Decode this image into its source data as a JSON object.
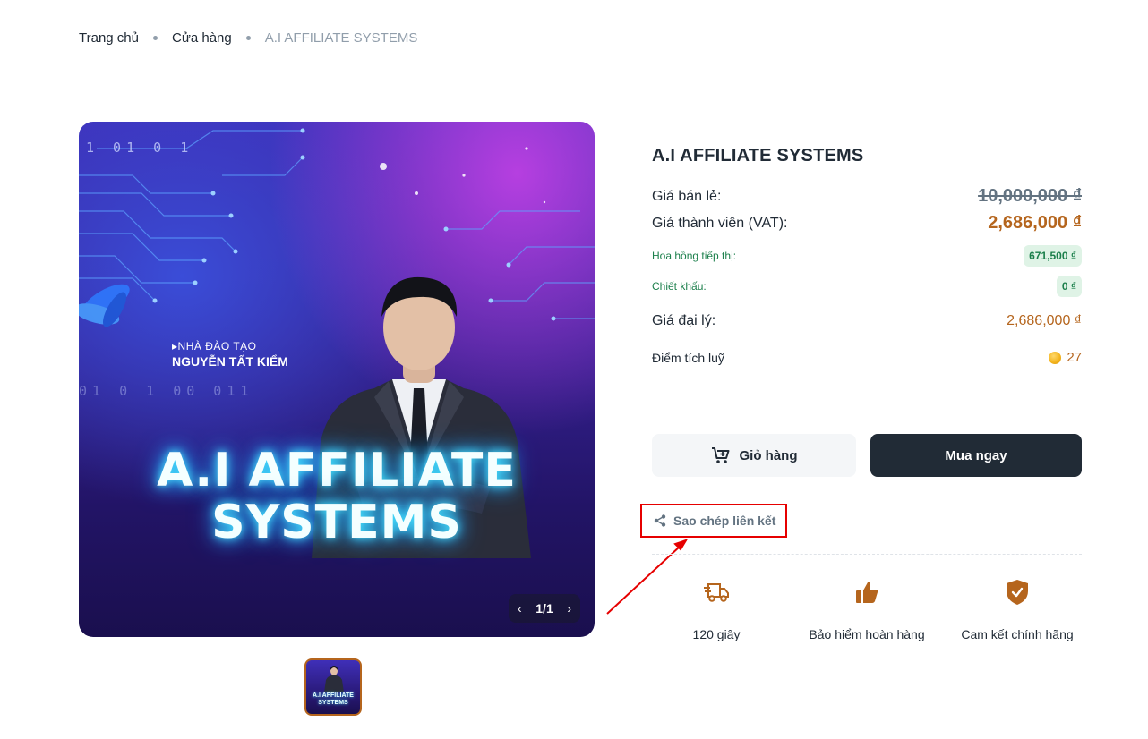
{
  "breadcrumb": {
    "items": [
      "Trang chủ",
      "Cửa hàng",
      "A.I AFFILIATE SYSTEMS"
    ]
  },
  "gallery": {
    "image_text": {
      "binary_top": "1   01 0 1",
      "binary_mid": "01 0 1  00  011",
      "trainer_label": "▸NHÀ ĐÀO TẠO",
      "trainer_name": "NGUYỄN TẤT KIỂM",
      "headline_line1": "A.I AFFILIATE",
      "headline_line2": "SYSTEMS"
    },
    "pager": "1/1",
    "thumbnail_text": {
      "line1": "A.I AFFILIATE",
      "line2": "SYSTEMS"
    }
  },
  "product": {
    "title": "A.I AFFILIATE SYSTEMS",
    "retail_label": "Giá bán lẻ:",
    "retail_price": "10,000,000 ₫",
    "member_label": "Giá thành viên (VAT):",
    "member_price": "2,686,000 ₫",
    "commission_label": "Hoa hồng tiếp thị:",
    "commission_value": "671,500 ₫",
    "discount_label": "Chiết khấu:",
    "discount_value": "0 ₫",
    "agent_label": "Giá đại lý:",
    "agent_price": "2,686,000 ₫",
    "points_label": "Điểm tích luỹ",
    "points_value": "27"
  },
  "actions": {
    "cart_label": "Giỏ hàng",
    "buy_label": "Mua ngay",
    "copy_link_label": "Sao chép liên kết"
  },
  "features": [
    {
      "icon": "delivery-truck-icon",
      "label": "120 giây"
    },
    {
      "icon": "thumbs-up-icon",
      "label": "Bảo hiểm hoàn hàng"
    },
    {
      "icon": "shield-check-icon",
      "label": "Cam kết chính hãng"
    }
  ],
  "colors": {
    "accent": "#b5651d",
    "dark": "#212b36",
    "green": "#1b7f4b",
    "annotation_red": "#e60000"
  }
}
